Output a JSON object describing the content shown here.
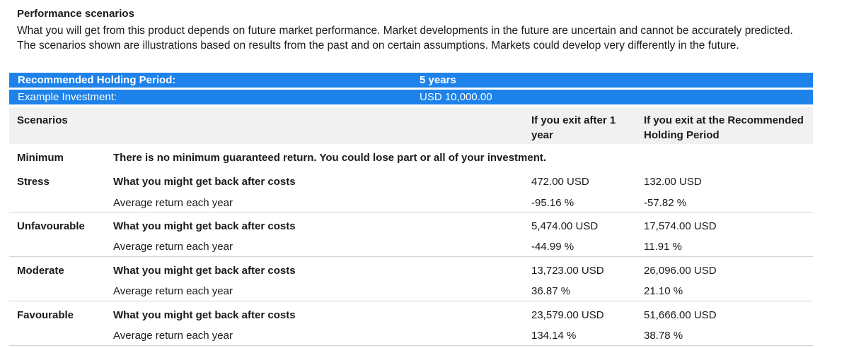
{
  "section": {
    "title": "Performance scenarios",
    "intro_1": "What you will get from this product depends on future market performance. Market developments in the future are uncertain and cannot be accurately predicted.",
    "intro_2": "The scenarios shown are illustrations based on results from the past and on certain assumptions. Markets could develop very differently in the future."
  },
  "holding": {
    "label": "Recommended Holding Period:",
    "value": "5 years"
  },
  "investment": {
    "label": "Example Investment:",
    "value": "USD 10,000.00"
  },
  "table": {
    "headers": {
      "scenarios": "Scenarios",
      "exit_1_year": "If you exit after 1 year",
      "exit_rhp": "If you exit at the Recommended Holding Period"
    },
    "minimum": {
      "name": "Minimum",
      "text": "There is no minimum guaranteed return. You could lose part or all of your investment."
    },
    "rows": [
      {
        "name": "Stress",
        "costs_label": "What you might get back after costs",
        "return_label": "Average return each year",
        "y1_amount": "472.00 USD",
        "y1_return": "-95.16  %",
        "rhp_amount": "132.00 USD",
        "rhp_return": "-57.82  %"
      },
      {
        "name": "Unfavourable",
        "costs_label": "What you might get back after costs",
        "return_label": "Average return each year",
        "y1_amount": "5,474.00 USD",
        "y1_return": "-44.99  %",
        "rhp_amount": "17,574.00 USD",
        "rhp_return": "11.91  %"
      },
      {
        "name": "Moderate",
        "costs_label": "What you might get back after costs",
        "return_label": "Average return each year",
        "y1_amount": "13,723.00 USD",
        "y1_return": "36.87  %",
        "rhp_amount": "26,096.00 USD",
        "rhp_return": "21.10  %"
      },
      {
        "name": "Favourable",
        "costs_label": "What you might get back after costs",
        "return_label": "Average return each year",
        "y1_amount": "23,579.00 USD",
        "y1_return": "134.14  %",
        "rhp_amount": "51,666.00 USD",
        "rhp_return": "38.78  %"
      }
    ]
  }
}
